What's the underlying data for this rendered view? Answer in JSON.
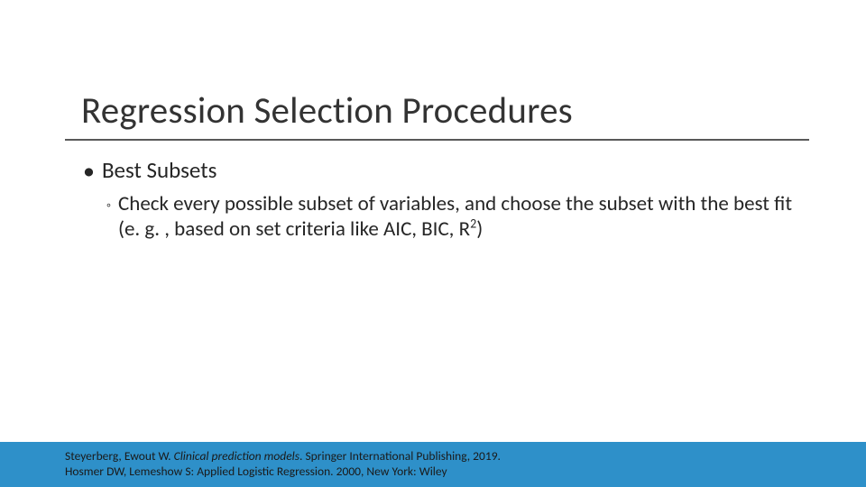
{
  "title": "Regression Selection Procedures",
  "bullets": {
    "level1": "Best Subsets",
    "level2_pre": "Check every possible subset of variables, and choose the subset with the best fit (e. g. , based on set criteria like AIC, BIC, R",
    "level2_sup": "2",
    "level2_post": ")"
  },
  "citations": {
    "line1_author": "Steyerberg, Ewout W. ",
    "line1_title": "Clinical prediction models",
    "line1_rest": ". Springer International Publishing, 2019.",
    "line2": "Hosmer DW, Lemeshow S: Applied Logistic Regression. 2000, New York: Wiley"
  }
}
